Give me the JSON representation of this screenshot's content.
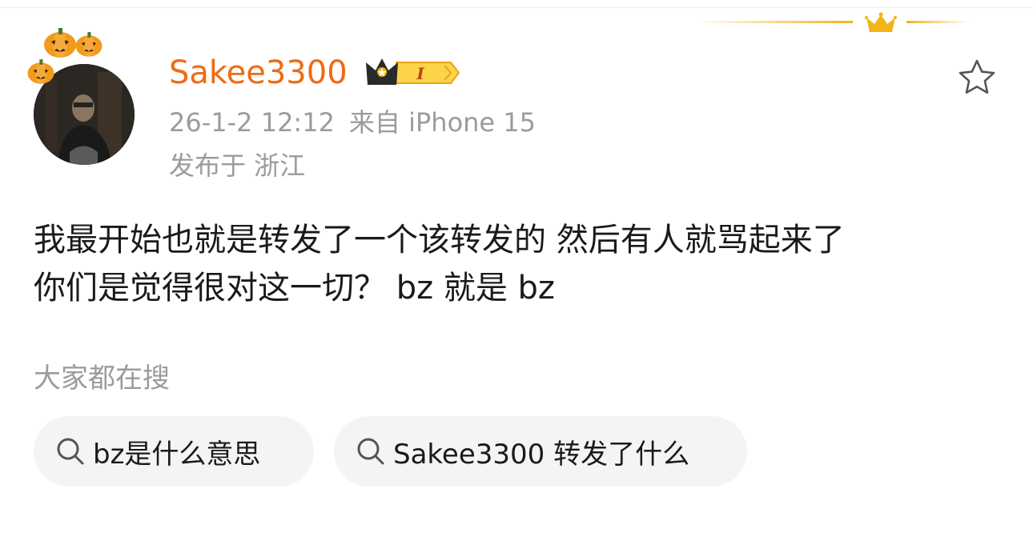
{
  "post": {
    "username": "Sakee3300",
    "level_badge": "I",
    "timestamp": "26-1-2 12:12",
    "source": "来自 iPhone 15",
    "location": "发布于 浙江",
    "content_lines": [
      "我最开始也就是转发了一个该转发的 然后有人就骂起来了",
      "你们是觉得很对这一切？  bz 就是 bz"
    ]
  },
  "trending": {
    "title": "大家都在搜",
    "chips": [
      {
        "label": "bz是什么意思",
        "icon": "search-icon"
      },
      {
        "label": "Sakee3300 转发了什么",
        "icon": "search-icon"
      }
    ]
  },
  "icons": {
    "favorite": "star-outline-icon",
    "crown": "crown-icon",
    "avatar_decoration": "pumpkin-icon"
  },
  "colors": {
    "username": "#f06a12",
    "meta": "#9b9b9b",
    "text": "#1a1a1a",
    "chip_bg": "#f4f4f4",
    "gold": "#f2b418"
  }
}
